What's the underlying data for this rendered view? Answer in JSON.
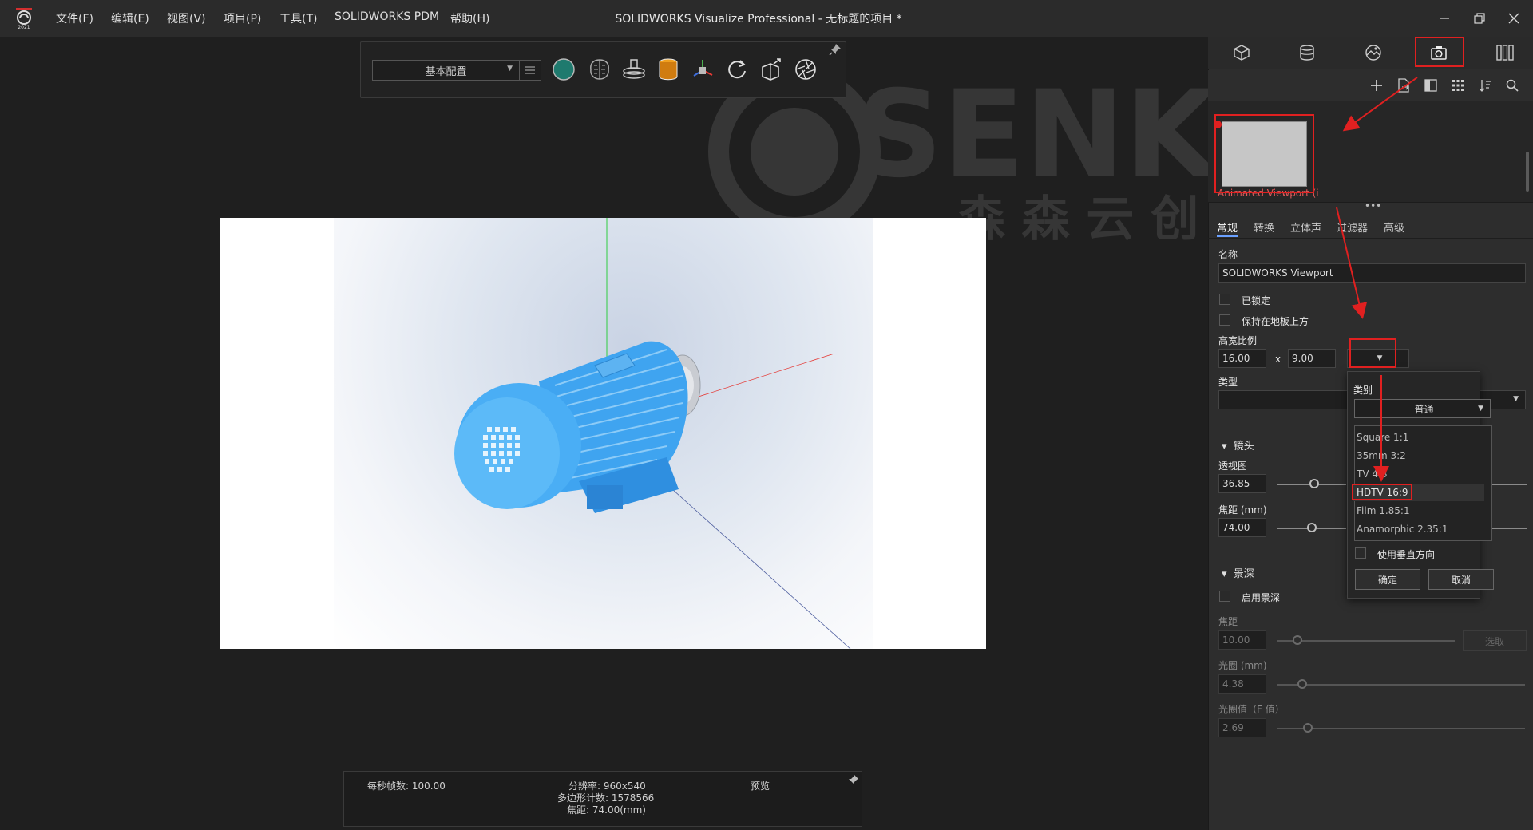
{
  "titlebar": {
    "menus": [
      "文件(F)",
      "编辑(E)",
      "视图(V)",
      "项目(P)",
      "工具(T)",
      "SOLIDWORKS PDM",
      "帮助(H)"
    ],
    "title": "SOLIDWORKS Visualize Professional - 无标题的项目 *",
    "logo_year": "2021"
  },
  "toolbar": {
    "config_value": "基本配置",
    "icons": [
      "environment-sphere-icon",
      "brain-icon",
      "turntable-icon",
      "material-bucket-icon",
      "xyz-gizmo-icon",
      "refresh-icon",
      "export-box-icon",
      "aperture-icon"
    ]
  },
  "status": {
    "fps": "每秒帧数: 100.00",
    "resolution": "分辨率: 960x540",
    "polygons": "多边形计数: 1578566",
    "focal": "焦距: 74.00(mm)",
    "mode": "预览"
  },
  "panel": {
    "main_tabs": [
      "model-cube-icon",
      "appearance-cylinder-icon",
      "scene-landscape-icon",
      "camera-icon",
      "libraries-columns-icon"
    ],
    "list_tools": [
      "add-icon",
      "export-file-icon",
      "split-view-icon",
      "grid-view-icon",
      "sort-icon",
      "search-icon"
    ],
    "camera_name": "Animated Viewport (i",
    "subtabs": [
      "常规",
      "转换",
      "立体声",
      "过滤器",
      "高级"
    ],
    "name_label": "名称",
    "name_value": "SOLIDWORKS Viewport",
    "locked": "已锁定",
    "keep_above_floor": "保持在地板上方",
    "aspect_label": "高宽比例",
    "aspect_w": "16.00",
    "aspect_x": "x",
    "aspect_h": "9.00",
    "type_label": "类型",
    "lens_section": "镜头",
    "perspective_label": "透视图",
    "perspective_value": "36.85",
    "focal_label": "焦距 (mm)",
    "focal_value": "74.00",
    "dof_section": "景深",
    "enable_dof": "启用景深",
    "focus_label": "焦距",
    "focus_value": "10.00",
    "focus_btn": "选取",
    "aperture_label": "光圈 (mm)",
    "aperture_value": "4.38",
    "fstop_label": "光圈值（F 值）",
    "fstop_value": "2.69"
  },
  "popup": {
    "category_label": "类别",
    "category_value": "普通",
    "options": [
      "Square 1:1",
      "35mm 3:2",
      "TV 4:3",
      "HDTV 16:9",
      "Film 1.85:1",
      "Anamorphic 2.35:1"
    ],
    "selected_index": 3,
    "use_vertical": "使用垂直方向",
    "ok": "确定",
    "cancel": "取消"
  },
  "watermark": {
    "text": "SENKE",
    "sub": "森  森  云  创"
  },
  "colors": {
    "accent_red": "#e02020",
    "motor_blue": "#3fa4f0"
  }
}
